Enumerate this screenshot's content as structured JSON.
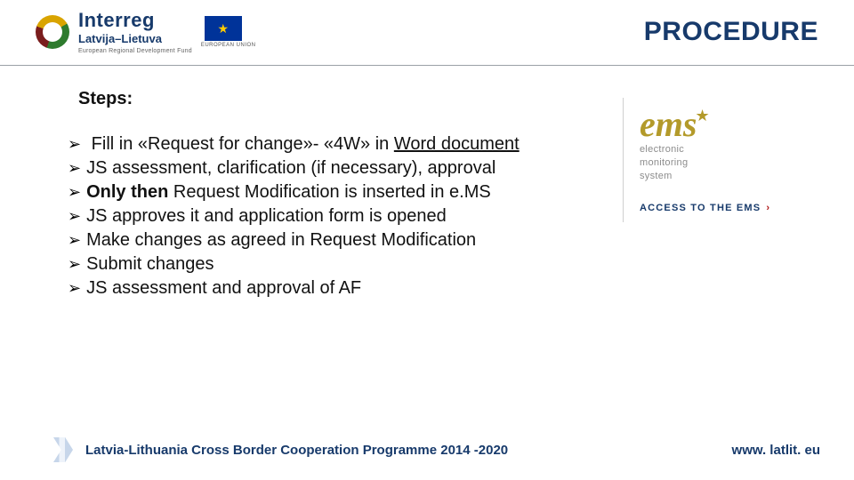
{
  "header": {
    "brand": "Interreg",
    "sub": "Latvija–Lietuva",
    "tiny": "European Regional Development Fund",
    "eu_caption": "EUROPEAN UNION",
    "title": "PROCEDURE"
  },
  "steps_heading": "Steps:",
  "steps": [
    {
      "pre": "Fill in «Request for change»- «4W» in ",
      "underlined": "Word document",
      "post": ""
    },
    {
      "pre": "JS assessment, clarification (if necessary), approval"
    },
    {
      "bold": "Only then",
      "post": " Request Modification is inserted in e.MS"
    },
    {
      "pre": "JS approves it and application form is opened"
    },
    {
      "pre": "Make changes as agreed in Request Modification"
    },
    {
      "pre": "Submit changes"
    },
    {
      "pre": "JS assessment and approval of AF"
    }
  ],
  "ems": {
    "logo": "ems",
    "sub1": "electronic",
    "sub2": "monitoring",
    "sub3": "system",
    "access": "ACCESS TO THE EMS"
  },
  "footer": {
    "programme": "Latvia-Lithuania Cross Border Cooperation Programme 2014 -2020",
    "url": "www. latlit. eu"
  }
}
